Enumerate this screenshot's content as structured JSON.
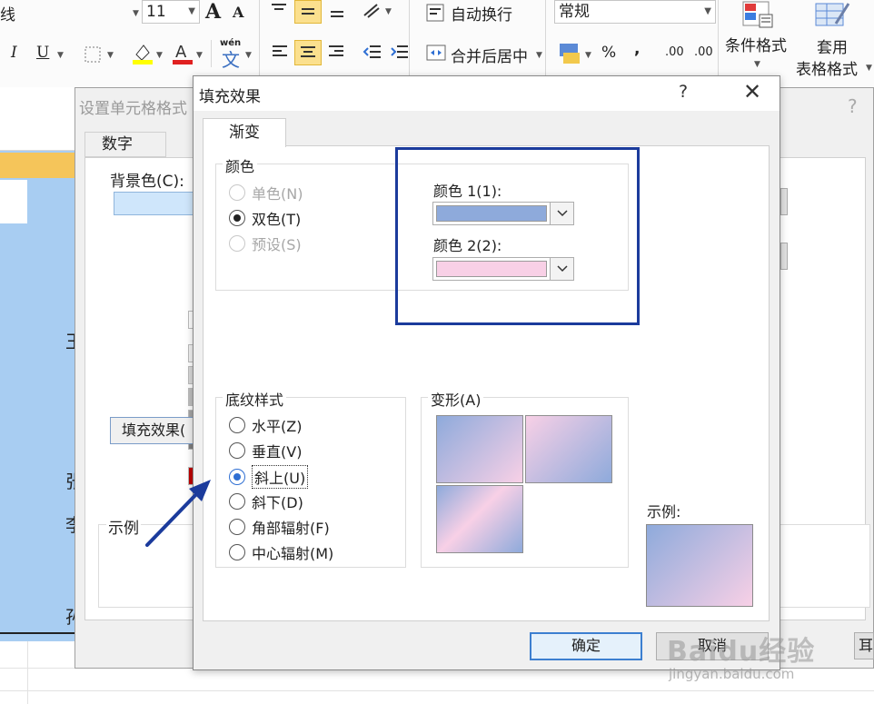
{
  "ribbon": {
    "font_partial": "线",
    "font_size": "11",
    "wrap_text": "自动换行",
    "number_format": "常规",
    "merge_center": "合并后居中",
    "percent": "%",
    "comma": "،",
    "dec_inc": ".00",
    "conditional_format": "条件格式",
    "table_format_line1": "套用",
    "table_format_line2": "表格格式",
    "bold_a": "A",
    "italic": "I",
    "underline": "U",
    "wen": "wén",
    "wen_char": "文"
  },
  "sheet": {
    "chars": [
      "王",
      "张",
      "李",
      "孙"
    ]
  },
  "back_dialog": {
    "title": "设置单元格格式",
    "help": "?",
    "tab_number": "数字",
    "bg_color_label": "背景色(C):",
    "fill_effects_button": "填充效果(",
    "example_label": "示例",
    "swatch_colors_row1": [
      "#ffffff",
      "#000000",
      "#e7e6e6",
      "#44546a"
    ],
    "swatch_grey_col1": [
      "#f2f2f2",
      "#d9d9d9",
      "#bfbfbf",
      "#a6a6a6",
      "#808080"
    ],
    "swatch_grey_col2": [
      "#7f7f7f",
      "#595959",
      "#3f3f3f",
      "#262626",
      "#0d0d0d"
    ],
    "swatch_grey_col3": [
      "#d0cece",
      "#aeabab",
      "#757171",
      "#3a3838",
      "#171616"
    ],
    "swatch_std": [
      "#c00000",
      "#ff0000",
      "#ffc000",
      "#ffff00"
    ]
  },
  "dialog": {
    "title": "填充效果",
    "help": "?",
    "close": "✕",
    "tab_gradient": "渐变",
    "colors_group": "颜色",
    "radio_one_color": "单色(N)",
    "radio_two_colors": "双色(T)",
    "radio_preset": "预设(S)",
    "color1_label": "颜色 1(1):",
    "color2_label": "颜色 2(2):",
    "color1_value": "#8eaadb",
    "color2_value": "#f8d0e6",
    "shading_group": "底纹样式",
    "shading_options": [
      "水平(Z)",
      "垂直(V)",
      "斜上(U)",
      "斜下(D)",
      "角部辐射(F)",
      "中心辐射(M)"
    ],
    "selected_shading": "斜上(U)",
    "variants_group": "变形(A)",
    "sample_label": "示例:",
    "ok_button": "确定",
    "cancel_button": "取消",
    "right_partial_button": "耳"
  },
  "annotation": {
    "highlight_color": "#1b3b9c",
    "arrow_color": "#1b3b9c"
  },
  "watermark": {
    "brand": "Baidu经验",
    "url": "jingyan.baidu.com"
  }
}
